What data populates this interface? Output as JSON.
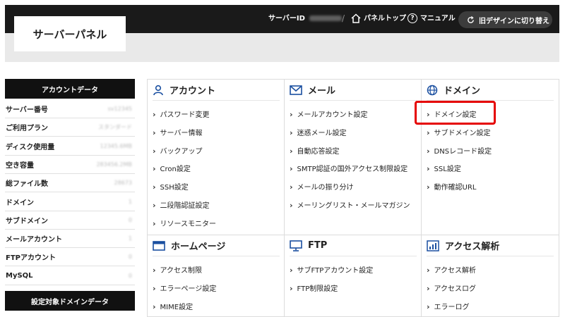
{
  "header": {
    "title": "サーバーパネル",
    "server_id_label": "サーバーID",
    "server_id_value": "xserverid",
    "separator": "/",
    "panel_top": "パネルトップ",
    "manual": "マニュアル",
    "old_design_button": "旧デザインに切り替え"
  },
  "sidebar": {
    "account_heading": "アカウントデータ",
    "rows": [
      {
        "label": "サーバー番号",
        "value": "sv12345"
      },
      {
        "label": "ご利用プラン",
        "value": "スタンダード"
      },
      {
        "label": "ディスク使用量",
        "value": "12345.6MB"
      },
      {
        "label": "空き容量",
        "value": "283456.2MB"
      },
      {
        "label": "総ファイル数",
        "value": "28673"
      },
      {
        "label": "ドメイン",
        "value": "1"
      },
      {
        "label": "サブドメイン",
        "value": "0"
      },
      {
        "label": "メールアカウント",
        "value": "1"
      },
      {
        "label": "FTPアカウント",
        "value": "0"
      },
      {
        "label": "MySQL",
        "value": "0"
      }
    ],
    "domain_heading": "設定対象ドメインデータ"
  },
  "sections": {
    "account": {
      "title": "アカウント",
      "links": [
        "パスワード変更",
        "サーバー情報",
        "バックアップ",
        "Cron設定",
        "SSH設定",
        "二段階認証設定",
        "リソースモニター"
      ]
    },
    "mail": {
      "title": "メール",
      "links": [
        "メールアカウント設定",
        "迷惑メール設定",
        "自動応答設定",
        "SMTP認証の国外アクセス制限設定",
        "メールの振り分け",
        "メーリングリスト・メールマガジン"
      ]
    },
    "domain": {
      "title": "ドメイン",
      "links": [
        "ドメイン設定",
        "サブドメイン設定",
        "DNSレコード設定",
        "SSL設定",
        "動作確認URL"
      ]
    },
    "homepage": {
      "title": "ホームページ",
      "links": [
        "アクセス制限",
        "エラーページ設定",
        "MIME設定"
      ]
    },
    "ftp": {
      "title": "FTP",
      "links": [
        "サブFTPアカウント設定",
        "FTP制限設定"
      ]
    },
    "analytics": {
      "title": "アクセス解析",
      "links": [
        "アクセス解析",
        "アクセスログ",
        "エラーログ"
      ]
    }
  },
  "colors": {
    "accent": "#1a4fa0",
    "highlight": "#e50000",
    "dark": "#111111"
  }
}
